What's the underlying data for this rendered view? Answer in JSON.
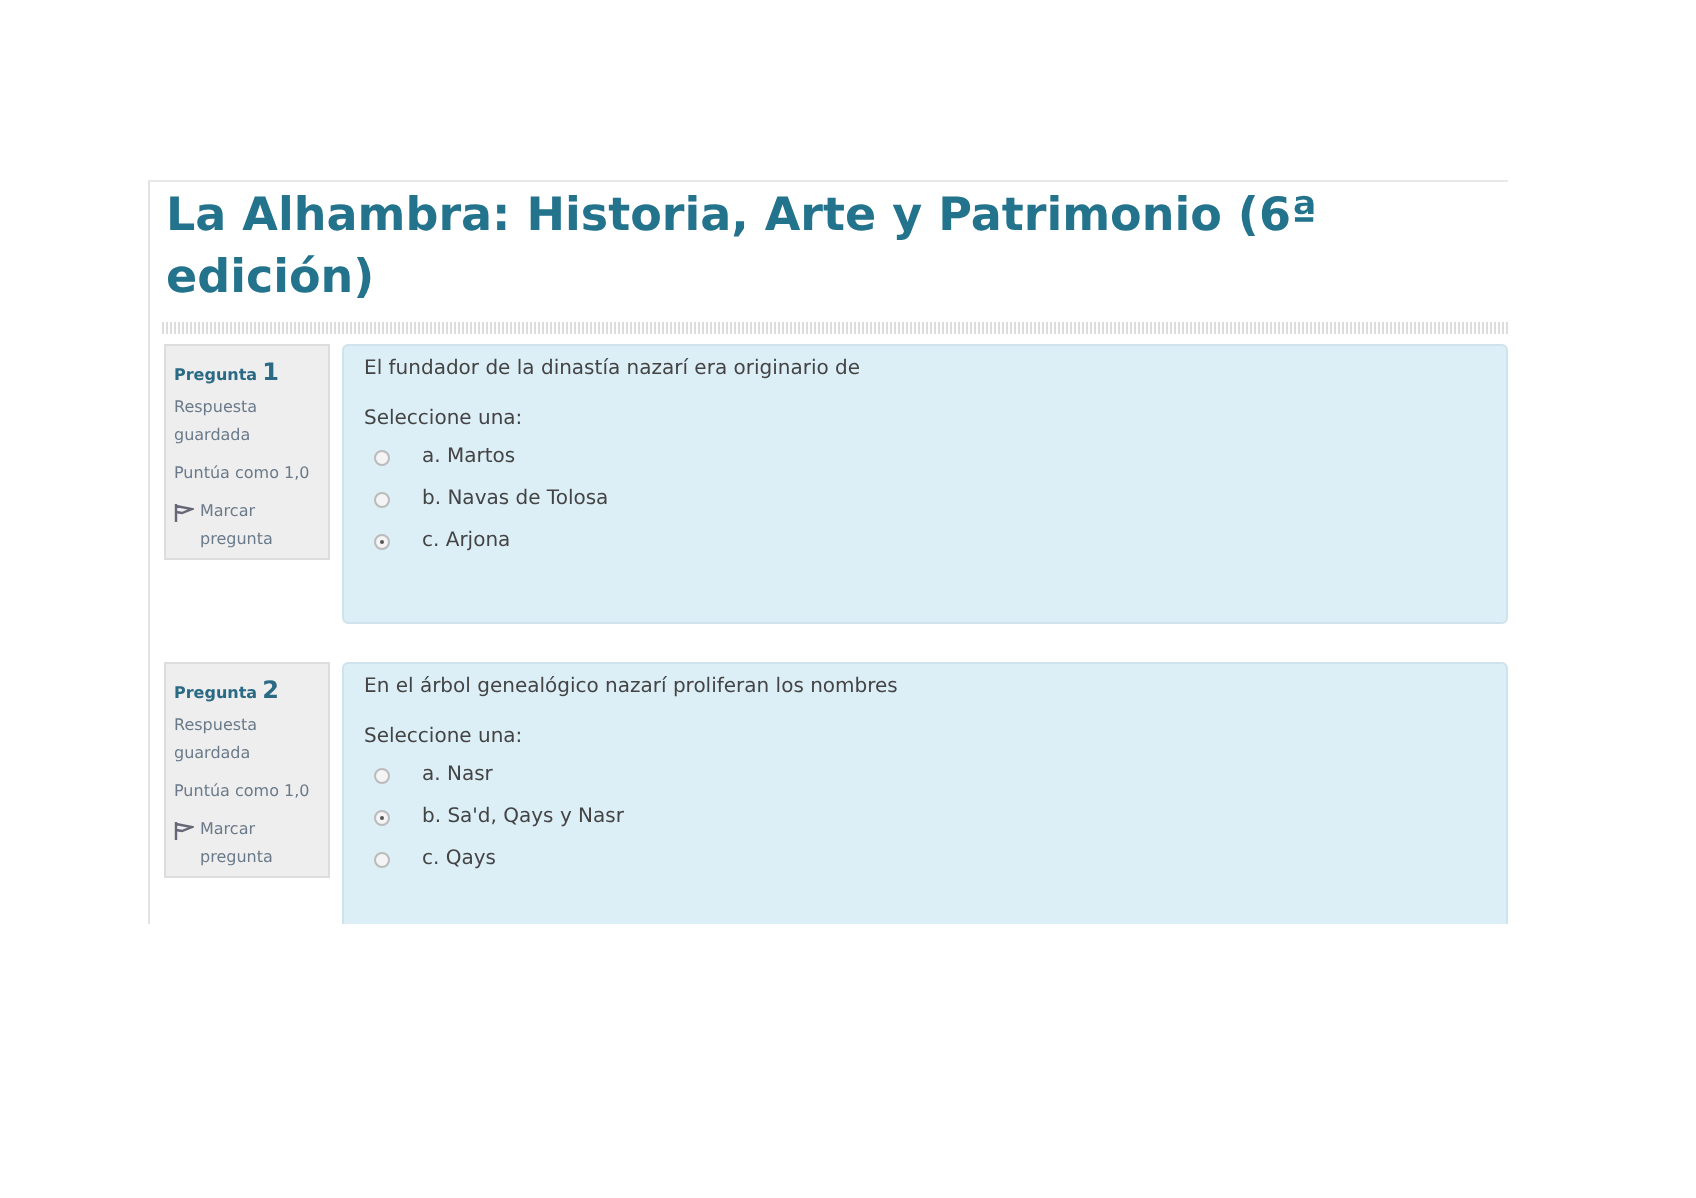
{
  "course_title": "La Alhambra: Historia, Arte y Patrimonio (6ª edición)",
  "questions": [
    {
      "label": "Pregunta",
      "number": "1",
      "status": "Respuesta guardada",
      "grade": "Puntúa como 1,0",
      "flag": "Marcar pregunta",
      "text": "El fundador de la dinastía nazarí era originario de",
      "prompt": "Seleccione una:",
      "options": [
        {
          "label": "a. Martos",
          "selected": false
        },
        {
          "label": "b. Navas de Tolosa",
          "selected": false
        },
        {
          "label": "c. Arjona",
          "selected": true
        }
      ]
    },
    {
      "label": "Pregunta",
      "number": "2",
      "status": "Respuesta guardada",
      "grade": "Puntúa como 1,0",
      "flag": "Marcar pregunta",
      "text": "En el árbol genealógico nazarí proliferan los nombres",
      "prompt": "Seleccione una:",
      "options": [
        {
          "label": "a. Nasr",
          "selected": false
        },
        {
          "label": "b. Sa'd, Qays y Nasr",
          "selected": true
        },
        {
          "label": "c. Qays",
          "selected": false
        }
      ]
    }
  ]
}
